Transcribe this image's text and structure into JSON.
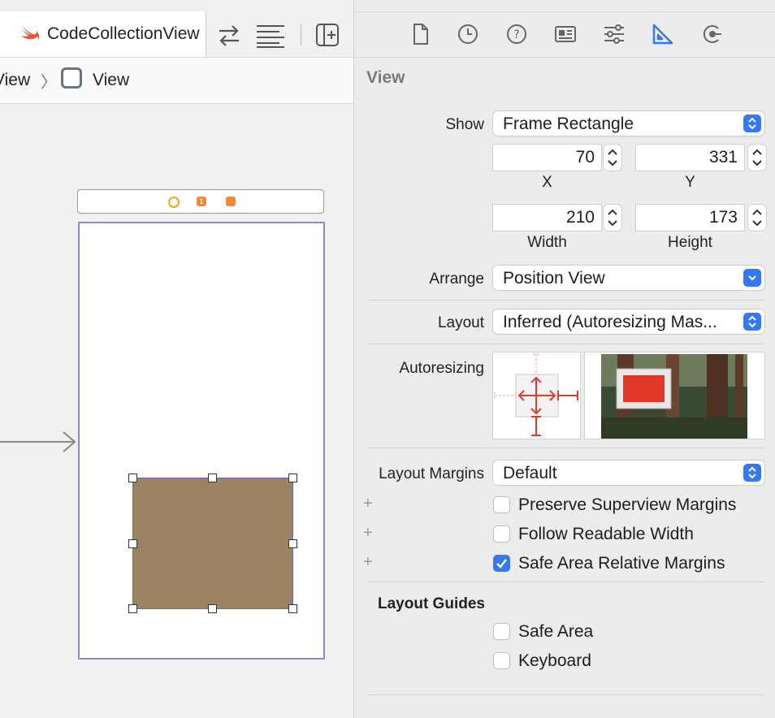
{
  "editor": {
    "tab_title": "CodeCollectionView",
    "breadcrumb_parent": "View",
    "breadcrumb_current": "View",
    "scene_badge": "1",
    "subview_color": "#9c8362"
  },
  "inspector": {
    "section_title": "View",
    "show": {
      "label": "Show",
      "value": "Frame Rectangle"
    },
    "frame": {
      "x": {
        "value": "70",
        "label": "X"
      },
      "y": {
        "value": "331",
        "label": "Y"
      },
      "width": {
        "value": "210",
        "label": "Width"
      },
      "height": {
        "value": "173",
        "label": "Height"
      }
    },
    "arrange": {
      "label": "Arrange",
      "value": "Position View"
    },
    "layout": {
      "label": "Layout",
      "value": "Inferred (Autoresizing Mas..."
    },
    "autoresizing": {
      "label": "Autoresizing"
    },
    "layout_margins": {
      "label": "Layout Margins",
      "value": "Default"
    },
    "margin_options": [
      {
        "label": "Preserve Superview Margins",
        "checked": false
      },
      {
        "label": "Follow Readable Width",
        "checked": false
      },
      {
        "label": "Safe Area Relative Margins",
        "checked": true
      }
    ],
    "layout_guides": {
      "title": "Layout Guides",
      "options": [
        {
          "label": "Safe Area",
          "checked": false
        },
        {
          "label": "Keyboard",
          "checked": false
        }
      ]
    }
  },
  "icons": {
    "tab_bar": [
      "swift-icon",
      "swap-arrows-icon",
      "lines-icon",
      "add-editor-icon"
    ],
    "inspector_tabs": [
      "file-icon",
      "history-icon",
      "help-icon",
      "identity-icon",
      "attributes-icon",
      "size-icon",
      "connections-icon"
    ]
  },
  "colors": {
    "accent": "#3478f6",
    "device_border": "#8b8cd4",
    "autoresize_red": "#e0392b"
  }
}
